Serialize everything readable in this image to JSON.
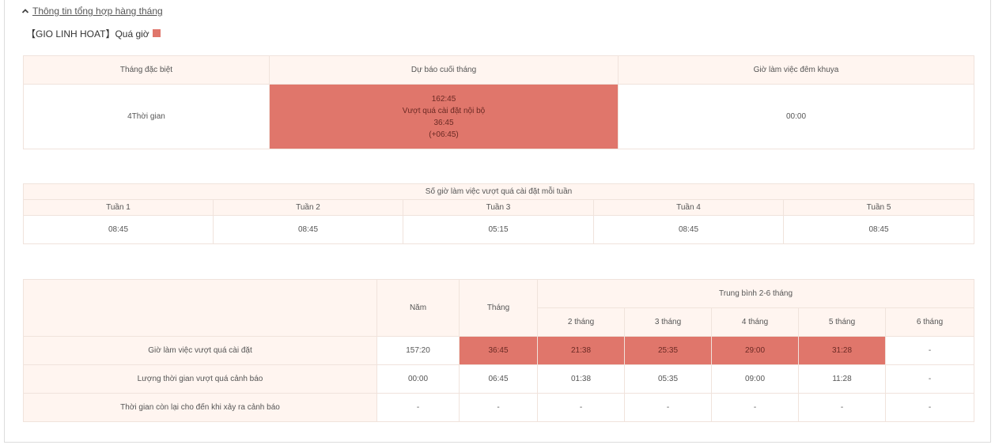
{
  "section_toggle": "Thông tin tổng hợp hàng tháng",
  "status": {
    "label": "【GIO LINH HOAT】Quá giờ",
    "overtime_color": "#e0766b"
  },
  "summary": {
    "headers": [
      "Tháng đặc biệt",
      "Dự báo cuối tháng",
      "Giờ làm việc đêm khuya"
    ],
    "special_month": "4Thời gian",
    "forecast_lines": [
      "162:45",
      "Vượt quá cài đặt nội bộ",
      "36:45",
      "(+06:45)"
    ],
    "late_night": "00:00"
  },
  "weekly": {
    "title": "Số giờ làm việc vượt quá cài đặt mỗi tuần",
    "weeks": [
      "Tuần 1",
      "Tuần 2",
      "Tuần 3",
      "Tuần 4",
      "Tuần 5"
    ],
    "values": [
      "08:45",
      "08:45",
      "05:15",
      "08:45",
      "08:45"
    ]
  },
  "averages": {
    "col_year": "Năm",
    "col_month": "Tháng",
    "group_label": "Trung bình 2-6 tháng",
    "sub_cols": [
      "2 tháng",
      "3 tháng",
      "4 tháng",
      "5 tháng",
      "6 tháng"
    ],
    "rows": [
      {
        "label": "Giờ làm việc vượt quá cài đặt",
        "cells": [
          "157:20",
          "36:45",
          "21:38",
          "25:35",
          "29:00",
          "31:28",
          "-"
        ],
        "hot": [
          false,
          true,
          true,
          true,
          true,
          true,
          false
        ]
      },
      {
        "label": "Lượng thời gian vượt quá cảnh báo",
        "cells": [
          "00:00",
          "06:45",
          "01:38",
          "05:35",
          "09:00",
          "11:28",
          "-"
        ],
        "hot": [
          false,
          false,
          false,
          false,
          false,
          false,
          false
        ]
      },
      {
        "label": "Thời gian còn lại cho đến khi xảy ra cảnh báo",
        "cells": [
          "-",
          "-",
          "-",
          "-",
          "-",
          "-",
          "-"
        ],
        "hot": [
          false,
          false,
          false,
          false,
          false,
          false,
          false
        ]
      }
    ]
  }
}
